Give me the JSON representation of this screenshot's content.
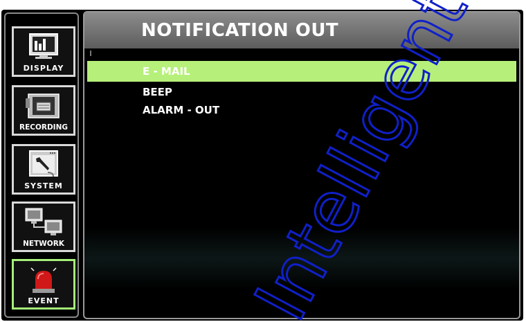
{
  "sidebar": {
    "items": [
      {
        "label": "DISPLAY",
        "icon": "display-icon",
        "active": false
      },
      {
        "label": "RECORDING",
        "icon": "camera-icon",
        "active": false
      },
      {
        "label": "SYSTEM",
        "icon": "wrench-icon",
        "active": false
      },
      {
        "label": "NETWORK",
        "icon": "network-icon",
        "active": false
      },
      {
        "label": "EVENT",
        "icon": "siren-icon",
        "active": true
      }
    ]
  },
  "header": {
    "title": "NOTIFICATION OUT"
  },
  "menu": {
    "items": [
      {
        "label": "E - MAIL",
        "selected": true
      },
      {
        "label": "BEEP",
        "selected": false
      },
      {
        "label": "ALARM - OUT",
        "selected": false
      }
    ]
  },
  "watermark": {
    "text": "Intelligent Security",
    "color": "#1020c8"
  },
  "colors": {
    "selected_row": "#b6f07a",
    "active_border": "#a6f07a"
  }
}
